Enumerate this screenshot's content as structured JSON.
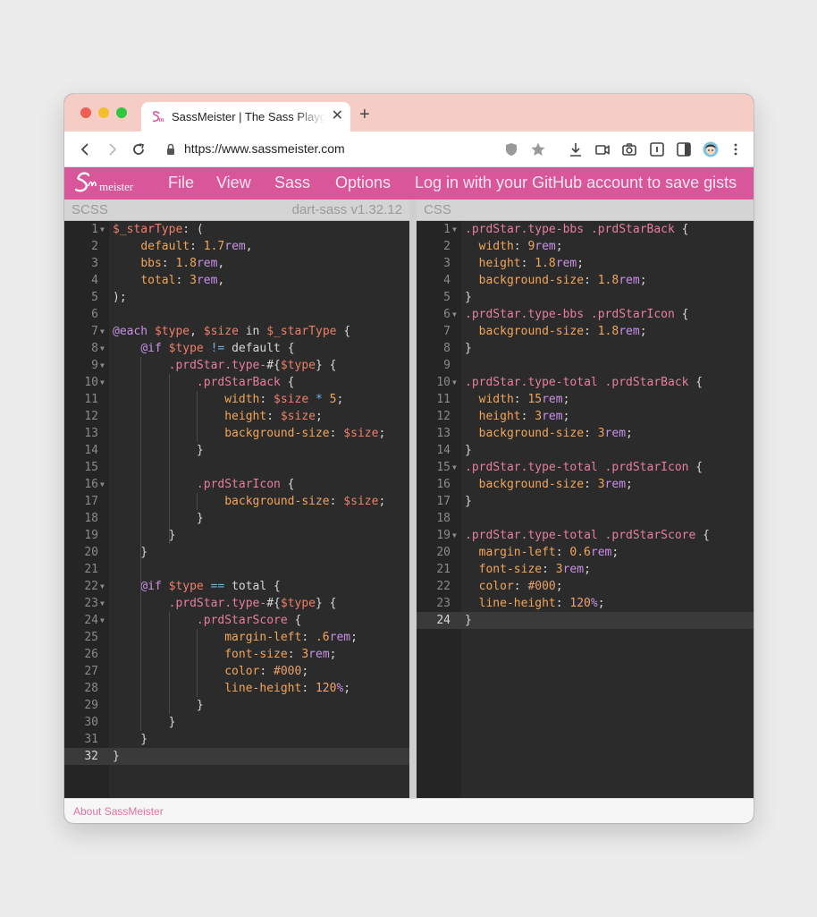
{
  "browser": {
    "tab_title": "SassMeister | The Sass Playground!",
    "url": "https://www.sassmeister.com",
    "new_tab_label": "+",
    "close_label": "✕"
  },
  "nav": {
    "logo_text": "Sassmeister",
    "items": [
      "File",
      "View",
      "Sass",
      "Options",
      "Log in with your GitHub account to save gists"
    ]
  },
  "scss_panel": {
    "title": "SCSS",
    "engine": "dart-sass v1.32.12",
    "active_line": 32,
    "lines": [
      {
        "n": 1,
        "fold": true,
        "t": "$_starType: ("
      },
      {
        "n": 2,
        "fold": false,
        "t": "    default: 1.7rem,"
      },
      {
        "n": 3,
        "fold": false,
        "t": "    bbs: 1.8rem,"
      },
      {
        "n": 4,
        "fold": false,
        "t": "    total: 3rem,"
      },
      {
        "n": 5,
        "fold": false,
        "t": ");"
      },
      {
        "n": 6,
        "fold": false,
        "t": ""
      },
      {
        "n": 7,
        "fold": true,
        "t": "@each $type, $size in $_starType {"
      },
      {
        "n": 8,
        "fold": true,
        "t": "    @if $type != default {"
      },
      {
        "n": 9,
        "fold": true,
        "t": "        .prdStar.type-#{$type} {"
      },
      {
        "n": 10,
        "fold": true,
        "t": "            .prdStarBack {"
      },
      {
        "n": 11,
        "fold": false,
        "t": "                width: $size * 5;"
      },
      {
        "n": 12,
        "fold": false,
        "t": "                height: $size;"
      },
      {
        "n": 13,
        "fold": false,
        "t": "                background-size: $size;"
      },
      {
        "n": 14,
        "fold": false,
        "t": "            }"
      },
      {
        "n": 15,
        "fold": false,
        "t": ""
      },
      {
        "n": 16,
        "fold": true,
        "t": "            .prdStarIcon {"
      },
      {
        "n": 17,
        "fold": false,
        "t": "                background-size: $size;"
      },
      {
        "n": 18,
        "fold": false,
        "t": "            }"
      },
      {
        "n": 19,
        "fold": false,
        "t": "        }"
      },
      {
        "n": 20,
        "fold": false,
        "t": "    }"
      },
      {
        "n": 21,
        "fold": false,
        "t": ""
      },
      {
        "n": 22,
        "fold": true,
        "t": "    @if $type == total {"
      },
      {
        "n": 23,
        "fold": true,
        "t": "        .prdStar.type-#{$type} {"
      },
      {
        "n": 24,
        "fold": true,
        "t": "            .prdStarScore {"
      },
      {
        "n": 25,
        "fold": false,
        "t": "                margin-left: .6rem;"
      },
      {
        "n": 26,
        "fold": false,
        "t": "                font-size: 3rem;"
      },
      {
        "n": 27,
        "fold": false,
        "t": "                color: #000;"
      },
      {
        "n": 28,
        "fold": false,
        "t": "                line-height: 120%;"
      },
      {
        "n": 29,
        "fold": false,
        "t": "            }"
      },
      {
        "n": 30,
        "fold": false,
        "t": "        }"
      },
      {
        "n": 31,
        "fold": false,
        "t": "    }"
      },
      {
        "n": 32,
        "fold": false,
        "t": "}"
      }
    ]
  },
  "css_panel": {
    "title": "CSS",
    "active_line": 24,
    "lines": [
      {
        "n": 1,
        "fold": true,
        "t": ".prdStar.type-bbs .prdStarBack {"
      },
      {
        "n": 2,
        "fold": false,
        "t": "  width: 9rem;"
      },
      {
        "n": 3,
        "fold": false,
        "t": "  height: 1.8rem;"
      },
      {
        "n": 4,
        "fold": false,
        "t": "  background-size: 1.8rem;"
      },
      {
        "n": 5,
        "fold": false,
        "t": "}"
      },
      {
        "n": 6,
        "fold": true,
        "t": ".prdStar.type-bbs .prdStarIcon {"
      },
      {
        "n": 7,
        "fold": false,
        "t": "  background-size: 1.8rem;"
      },
      {
        "n": 8,
        "fold": false,
        "t": "}"
      },
      {
        "n": 9,
        "fold": false,
        "t": ""
      },
      {
        "n": 10,
        "fold": true,
        "t": ".prdStar.type-total .prdStarBack {"
      },
      {
        "n": 11,
        "fold": false,
        "t": "  width: 15rem;"
      },
      {
        "n": 12,
        "fold": false,
        "t": "  height: 3rem;"
      },
      {
        "n": 13,
        "fold": false,
        "t": "  background-size: 3rem;"
      },
      {
        "n": 14,
        "fold": false,
        "t": "}"
      },
      {
        "n": 15,
        "fold": true,
        "t": ".prdStar.type-total .prdStarIcon {"
      },
      {
        "n": 16,
        "fold": false,
        "t": "  background-size: 3rem;"
      },
      {
        "n": 17,
        "fold": false,
        "t": "}"
      },
      {
        "n": 18,
        "fold": false,
        "t": ""
      },
      {
        "n": 19,
        "fold": true,
        "t": ".prdStar.type-total .prdStarScore {"
      },
      {
        "n": 20,
        "fold": false,
        "t": "  margin-left: 0.6rem;"
      },
      {
        "n": 21,
        "fold": false,
        "t": "  font-size: 3rem;"
      },
      {
        "n": 22,
        "fold": false,
        "t": "  color: #000;"
      },
      {
        "n": 23,
        "fold": false,
        "t": "  line-height: 120%;"
      },
      {
        "n": 24,
        "fold": false,
        "t": "}"
      }
    ]
  },
  "footer": {
    "link": "About SassMeister"
  },
  "colors": {
    "brand_pink": "#d9569a",
    "editor_bg": "#2b2b2b",
    "tabstrip": "#f5cdc4"
  }
}
